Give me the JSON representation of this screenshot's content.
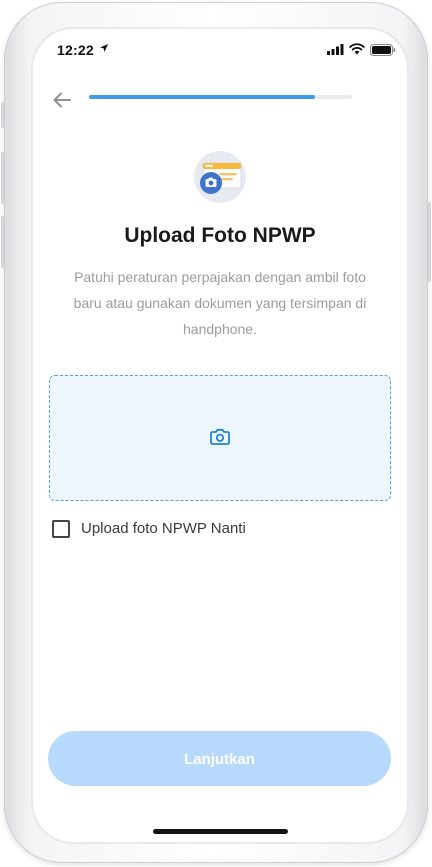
{
  "status_bar": {
    "time": "12:22"
  },
  "progress": {
    "fraction": 0.86,
    "color": "#3d9be9"
  },
  "header": {
    "title": "Upload Foto NPWP",
    "description": "Patuhi peraturan perpajakan dengan ambil foto baru atau gunakan dokumen yang tersimpan di handphone."
  },
  "upload": {
    "icon": "camera-icon",
    "border_color": "#4aa3e6",
    "fill_color": "#eef6fd"
  },
  "checkbox": {
    "label": "Upload foto NPWP Nanti",
    "checked": false
  },
  "cta": {
    "label": "Lanjutkan",
    "color": "#b7dafc",
    "disabled": true
  }
}
